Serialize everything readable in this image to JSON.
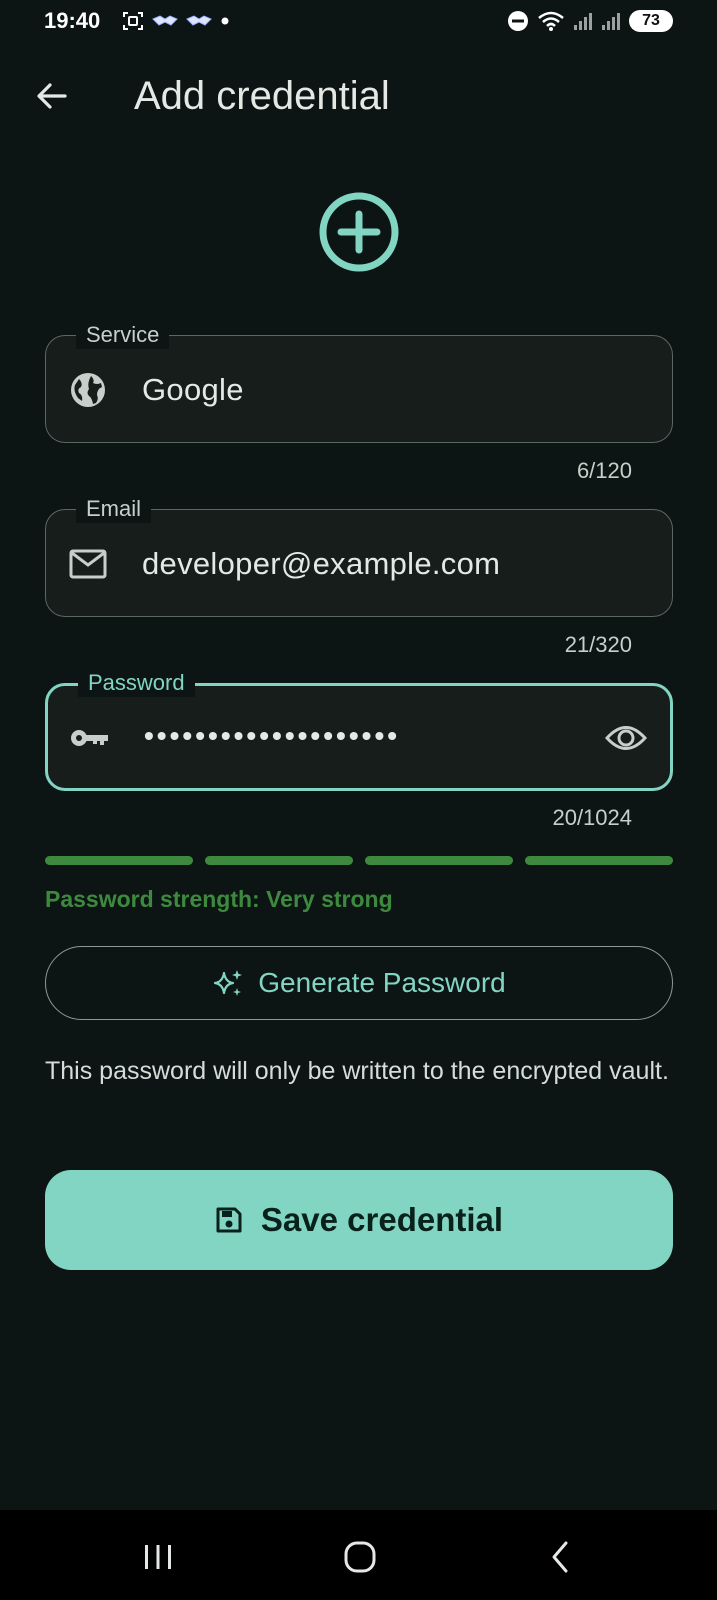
{
  "status_bar": {
    "time": "19:40",
    "battery": "73",
    "left_icons": [
      "screenshot-icon",
      "handshake-icon",
      "handshake-icon",
      "dot-icon"
    ],
    "right_icons": [
      "do-not-disturb-icon",
      "wifi-icon",
      "signal-icon",
      "signal-icon"
    ]
  },
  "app_bar": {
    "back_icon": "arrow-back-icon",
    "title": "Add credential"
  },
  "hero": {
    "icon": "add-circle-icon"
  },
  "form": {
    "service": {
      "label": "Service",
      "icon": "globe-icon",
      "value": "Google",
      "counter": "6/120"
    },
    "email": {
      "label": "Email",
      "icon": "mail-icon",
      "value": "developer@example.com",
      "counter": "21/320"
    },
    "password": {
      "label": "Password",
      "icon": "key-icon",
      "value": "••••••••••••••••••••",
      "counter": "20/1024",
      "trailing_icon": "eye-icon"
    }
  },
  "strength": {
    "segments_filled": 4,
    "segments_total": 4,
    "label": "Password strength: Very strong"
  },
  "generate_button": {
    "icon": "sparkle-icon",
    "label": "Generate Password"
  },
  "helper_text": "This password will only be written to the encrypted vault.",
  "save_button": {
    "icon": "save-icon",
    "label": "Save credential"
  },
  "nav_bar": {
    "items": [
      "recents-icon",
      "home-icon",
      "back-icon"
    ]
  },
  "colors": {
    "background": "#0c1513",
    "accent": "#83d5c3",
    "strength": "#3d8a3f",
    "field_fill": "#171d1b"
  }
}
